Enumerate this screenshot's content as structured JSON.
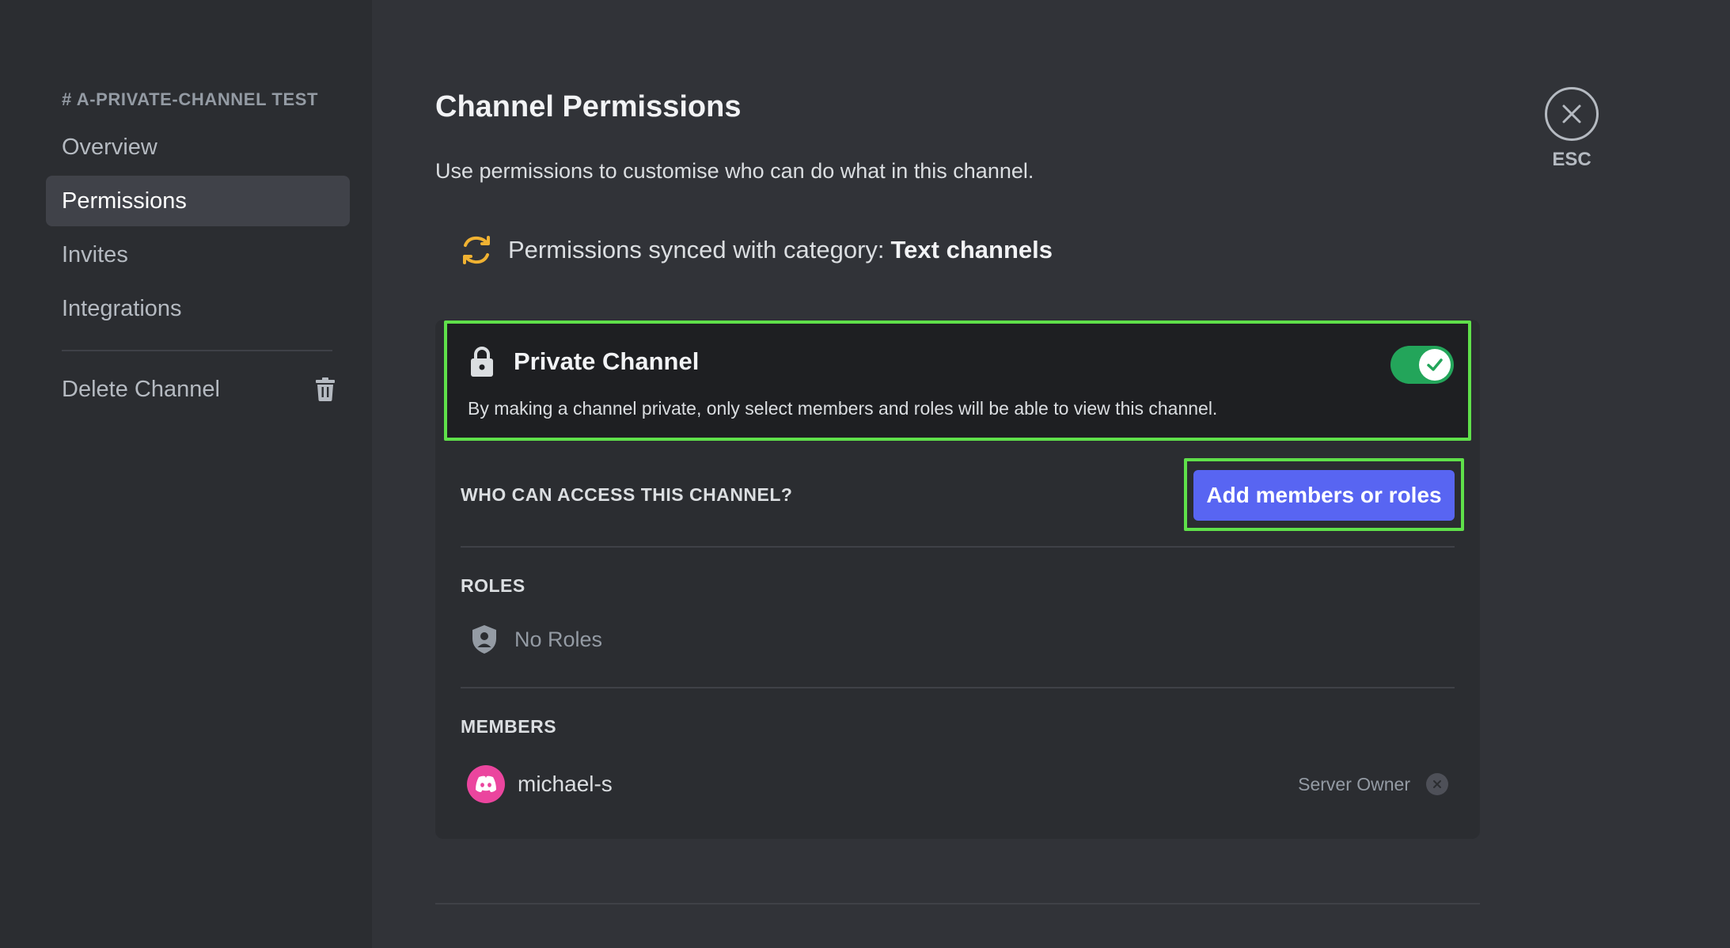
{
  "sidebar": {
    "header": "# A-PRIVATE-CHANNEL TEST",
    "items": [
      {
        "label": "Overview",
        "active": false
      },
      {
        "label": "Permissions",
        "active": true
      },
      {
        "label": "Invites",
        "active": false
      },
      {
        "label": "Integrations",
        "active": false
      }
    ],
    "delete_label": "Delete Channel"
  },
  "main": {
    "title": "Channel Permissions",
    "subtitle": "Use permissions to customise who can do what in this channel.",
    "sync_prefix": "Permissions synced with category:",
    "sync_category": "Text channels",
    "close_label": "ESC",
    "private_channel": {
      "title": "Private Channel",
      "description": "By making a channel private, only select members and roles will be able to view this channel.",
      "enabled": true
    },
    "access_heading": "WHO CAN ACCESS THIS CHANNEL?",
    "add_button": "Add members or roles",
    "roles_heading": "ROLES",
    "roles_empty": "No Roles",
    "members_heading": "MEMBERS",
    "members": [
      {
        "name": "michael-s",
        "role": "Server Owner"
      }
    ]
  },
  "colors": {
    "background": "#313338",
    "sidebar": "#2b2d31",
    "accent": "#5865f2",
    "toggle_on": "#23a55a",
    "highlight": "#5fe04a",
    "sync_icon": "#f0b232",
    "avatar": "#eb459e"
  },
  "icons": {
    "sync": "sync-icon",
    "lock": "lock-icon",
    "check": "check-icon",
    "shield": "shield-icon",
    "trash": "trash-icon",
    "close": "close-icon",
    "avatar": "discord-logo-icon"
  }
}
